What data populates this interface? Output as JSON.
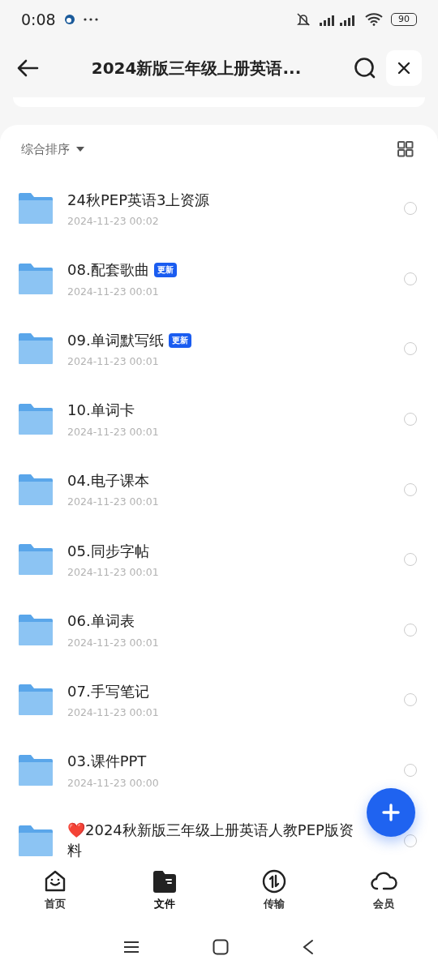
{
  "status_bar": {
    "time": "0:08",
    "battery": "90"
  },
  "header": {
    "title": "2024新版三年级上册英语..."
  },
  "sort": {
    "label": "综合排序"
  },
  "files": [
    {
      "name": "24秋PEP英语3上资源",
      "date": "2024-11-23 00:02",
      "checked": false
    },
    {
      "name": "08.配套歌曲",
      "badge": "更新",
      "date": "2024-11-23 00:01",
      "checked": false
    },
    {
      "name": "09.单词默写纸",
      "badge": "更新",
      "date": "2024-11-23 00:01",
      "checked": false
    },
    {
      "name": "10.单词卡",
      "date": "2024-11-23 00:01",
      "checked": false
    },
    {
      "name": "04.电子课本",
      "date": "2024-11-23 00:01",
      "checked": false
    },
    {
      "name": "05.同步字帖",
      "date": "2024-11-23 00:01",
      "checked": false
    },
    {
      "name": "06.单词表",
      "date": "2024-11-23 00:01",
      "checked": false
    },
    {
      "name": "07.手写笔记",
      "date": "2024-11-23 00:01",
      "checked": false
    },
    {
      "name": "03.课件PPT",
      "date": "2024-11-23 00:00",
      "checked": false
    },
    {
      "name": "❤️2024秋新版三年级上册英语人教PEP版资料",
      "checked": false
    }
  ],
  "bottom_nav": [
    {
      "label": "首页",
      "kind": "home",
      "selected": false
    },
    {
      "label": "文件",
      "kind": "files",
      "selected": true
    },
    {
      "label": "传输",
      "kind": "transfer",
      "selected": false
    },
    {
      "label": "会员",
      "kind": "vip",
      "selected": false
    }
  ]
}
